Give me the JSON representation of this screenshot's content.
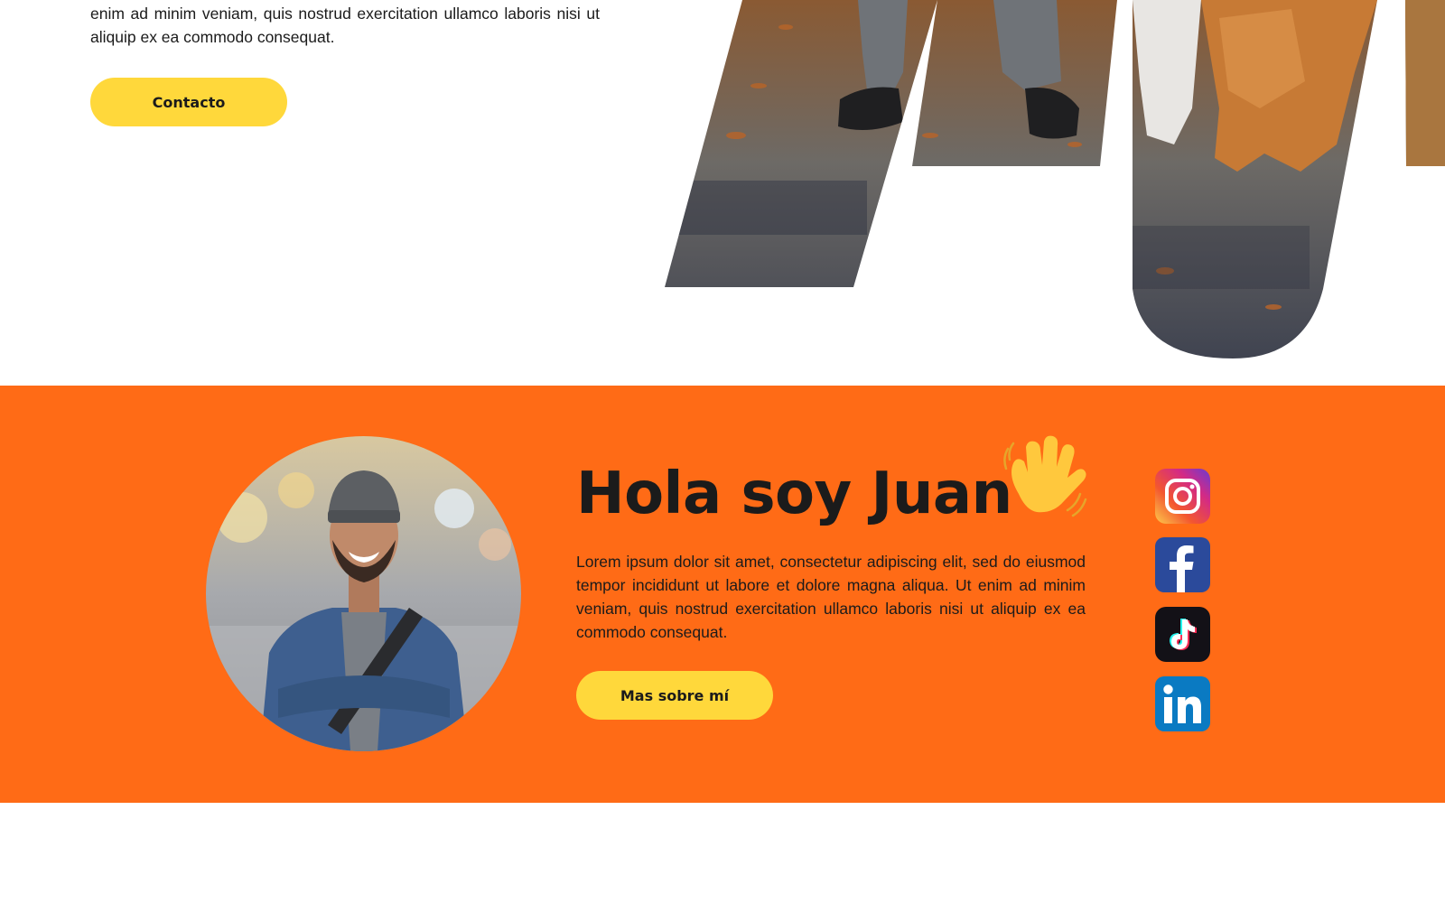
{
  "hero": {
    "paragraph": "enim ad minim veniam, quis nostrud exercitation ullamco laboris nisi ut aliquip ex ea commodo consequat.",
    "contact_button": "Contacto",
    "photo": "dog-walker-photo"
  },
  "about": {
    "title": "Hola soy Juan",
    "wave_icon": "waving-hand-icon",
    "paragraph": "Lorem ipsum dolor sit amet, consectetur adipiscing elit, sed do eiusmod tempor incididunt ut labore et dolore magna aliqua. Ut enim ad minim veniam, quis nostrud exercitation ullamco laboris nisi ut aliquip ex ea commodo consequat.",
    "more_button": "Mas sobre mí",
    "avatar": "profile-photo"
  },
  "social": [
    {
      "name": "instagram-icon"
    },
    {
      "name": "facebook-icon"
    },
    {
      "name": "tiktok-icon"
    },
    {
      "name": "linkedin-icon"
    }
  ],
  "colors": {
    "accent_orange": "#ff6b16",
    "button_yellow": "#ffd83b",
    "text_dark": "#1b1b1b",
    "background": "#ffffff"
  }
}
